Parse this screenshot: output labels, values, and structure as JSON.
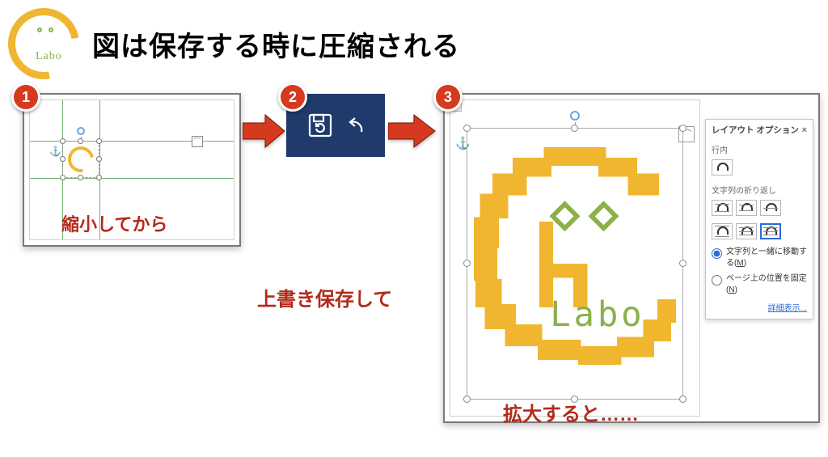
{
  "brand": {
    "labo_text": "Labo"
  },
  "heading": "図は保存する時に圧縮される",
  "steps": {
    "one": {
      "num": "1",
      "caption": "縮小してから"
    },
    "two": {
      "num": "2",
      "caption": "上書き保存して"
    },
    "three": {
      "num": "3",
      "caption": "拡大すると……"
    }
  },
  "layout_pane": {
    "title": "レイアウト オプション",
    "close": "×",
    "inline_label": "行内",
    "wrap_label": "文字列の折り返し",
    "radio_move": "文字列と一緒に移動する(",
    "radio_move_key": "M",
    "radio_move_suffix": ")",
    "radio_fix": "ページ上の位置を固定(",
    "radio_fix_key": "N",
    "radio_fix_suffix": ")",
    "details": "詳細表示..."
  },
  "big_logo": {
    "labo_text": "Labo"
  }
}
